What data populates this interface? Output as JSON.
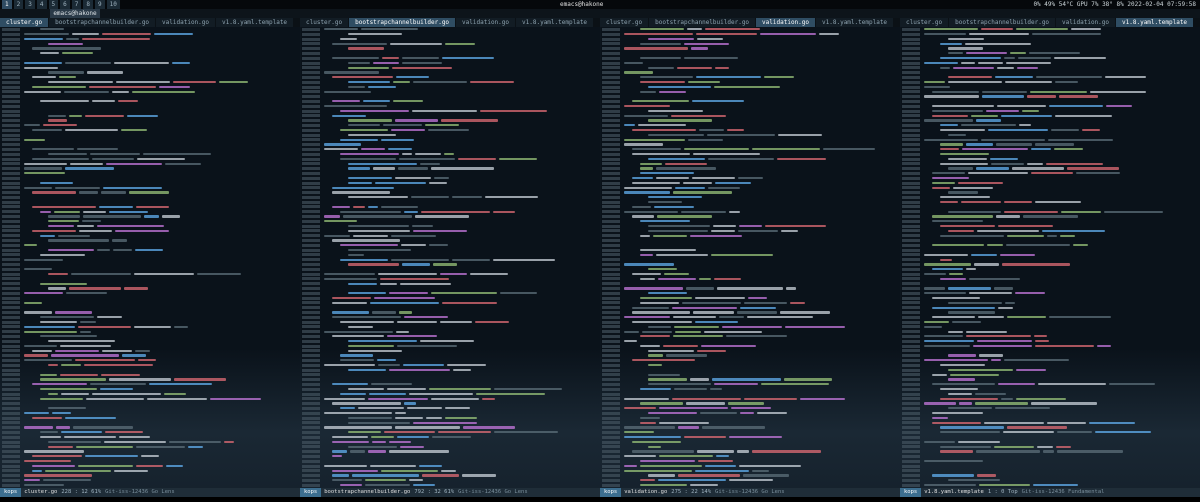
{
  "topbar": {
    "workspaces": [
      "1",
      "2",
      "3",
      "4",
      "5",
      "6",
      "7",
      "8",
      "9",
      "10"
    ],
    "active_workspace": "1",
    "window_title": "emacs@hakone",
    "status": "0%  49%  54°C  GPU 7%  38°  8%  2022-02-04 07:59:58"
  },
  "window_label": "emacs@hakone",
  "panes": [
    {
      "tabs": [
        "cluster.go",
        "bootstrapchannelbuilder.go",
        "validation.go",
        "v1.8.yaml.template"
      ],
      "active_tab": 0,
      "modeline": {
        "badge": "kops",
        "file": "cluster.go",
        "position": "228 : 12  61%",
        "extra": "Git-iss-12436  Go  Lens"
      },
      "line_start": 187
    },
    {
      "tabs": [
        "cluster.go",
        "bootstrapchannelbuilder.go",
        "validation.go",
        "v1.8.yaml.template"
      ],
      "active_tab": 1,
      "modeline": {
        "badge": "kops",
        "file": "bootstrapchannelbuilder.go",
        "position": "792 : 32  61%",
        "extra": "Git-iss-12436  Go  Lens"
      },
      "line_start": 662
    },
    {
      "tabs": [
        "cluster.go",
        "bootstrapchannelbuilder.go",
        "validation.go",
        "v1.8.yaml.template"
      ],
      "active_tab": 2,
      "modeline": {
        "badge": "kops",
        "file": "validation.go",
        "position": "275 : 22  14%",
        "extra": "Git-iss-12436  Go  Lens"
      },
      "line_start": 251
    },
    {
      "tabs": [
        "cluster.go",
        "bootstrapchannelbuilder.go",
        "validation.go",
        "v1.8.yaml.template"
      ],
      "active_tab": 3,
      "modeline": {
        "badge": "kops",
        "file": "v1.8.yaml.template",
        "position": "1 : 0  Top",
        "extra": "Git-iss-12436  Fundamental"
      },
      "line_start": 1
    }
  ],
  "colors": {
    "keyword": "#e06c75",
    "type": "#61afef",
    "string": "#98c379",
    "comment": "#5c6f7a",
    "func": "#c678dd",
    "plain": "#c9d1d9",
    "linenum": "#4a5a66",
    "highlight": "#c8a9ff"
  }
}
